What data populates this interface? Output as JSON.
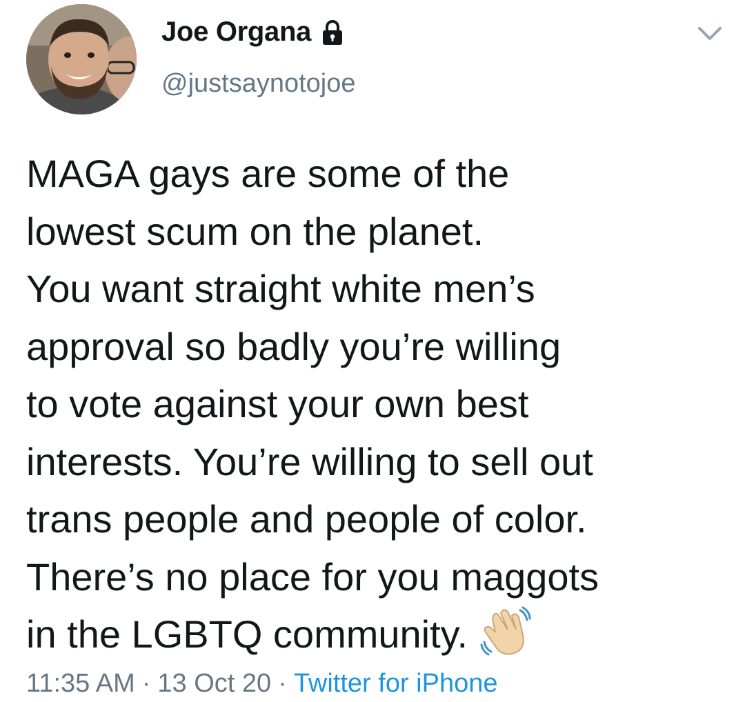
{
  "tweet": {
    "author": {
      "display_name": "Joe Organa",
      "handle": "@justsaynotojoe",
      "protected_icon": "lock-icon",
      "avatar": "profile-photo"
    },
    "menu_icon": "chevron-down-icon",
    "text_lines": [
      "MAGA gays are some of the",
      "lowest scum on the planet.",
      "You want straight white men’s",
      "approval so badly you’re willing",
      "to vote against your own best",
      "interests. You’re willing to sell out",
      "trans people and people of color.",
      "There’s no place for you maggots",
      "in the LGBTQ community."
    ],
    "emoji": "waving-hand-emoji",
    "time": "11:35 AM",
    "separator": "·",
    "date": "13 Oct 20",
    "source": "Twitter for iPhone"
  },
  "colors": {
    "text": "#14171a",
    "secondary": "#657786",
    "link": "#1b95e0",
    "background": "#ffffff"
  }
}
